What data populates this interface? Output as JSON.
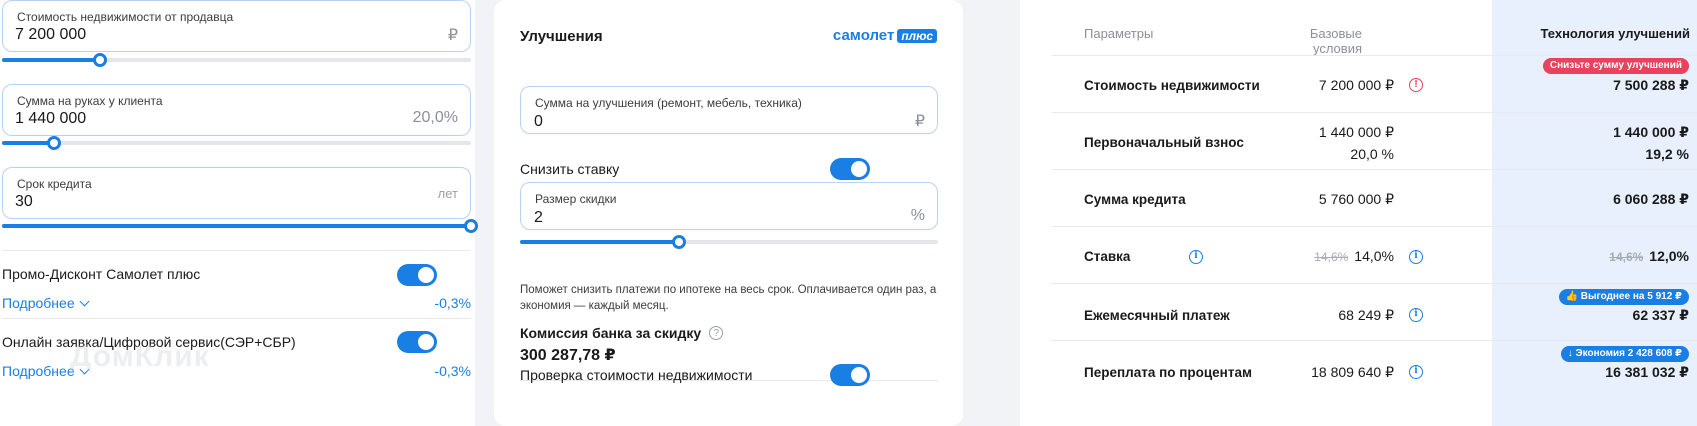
{
  "left": {
    "property_price": {
      "label": "Стоимость недвижимости от продавца",
      "value": "7 200 000",
      "suffix": "₽",
      "slider_fraction": 0.21
    },
    "client_cash": {
      "label": "Сумма на руках у клиента",
      "value": "1 440 000",
      "suffix": "20,0%",
      "slider_fraction": 0.11
    },
    "loan_term": {
      "label": "Срок кредита",
      "value": "30",
      "suffix": "лет",
      "slider_fraction": 1.0
    },
    "promos": [
      {
        "title": "Промо-Дисконт Самолет плюс",
        "more": "Подробнее",
        "pct": "-0,3%",
        "enabled": true
      },
      {
        "title": "Онлайн заявка/Цифровой сервис(СЭР+СБР)",
        "more": "Подробнее",
        "pct": "-0,3%",
        "enabled": true
      }
    ],
    "watermark": "ДомКлик"
  },
  "mid": {
    "title": "Улучшения",
    "brand": {
      "name": "самолет",
      "plus": "плюс"
    },
    "improvements": {
      "label": "Сумма на улучшения (ремонт, мебель, техника)",
      "value": "0",
      "suffix": "₽"
    },
    "lower_rate": {
      "label": "Снизить ставку",
      "enabled": true
    },
    "discount": {
      "label": "Размер скидки",
      "value": "2",
      "suffix": "%",
      "slider_fraction": 0.38
    },
    "hint": "Поможет снизить платежи по ипотеке на весь срок. Оплачивается один раз, а экономия — каждый месяц.",
    "commission": {
      "label": "Комиссия банка за скидку",
      "value": "300 287,78 ₽"
    },
    "check": {
      "label": "Проверка стоимости недвижимости",
      "enabled": true
    }
  },
  "table": {
    "headers": {
      "params": "Параметры",
      "base": "Базовые условия",
      "tech": "Технология улучшений"
    },
    "rows": [
      {
        "name": "Стоимость недвижимости",
        "base": "7 200 000 ₽",
        "tech": "7 500 288 ₽",
        "badge": "Снизьте сумму улучшений"
      },
      {
        "name": "Первоначальный взнос",
        "base": "1 440 000 ₽",
        "base2": "20,0 %",
        "tech": "1 440 000 ₽",
        "tech2": "19,2 %"
      },
      {
        "name": "Сумма кредита",
        "base": "5 760 000 ₽",
        "tech": "6 060 288 ₽"
      },
      {
        "name": "Ставка",
        "base_old": "14,6%",
        "base": "14,0%",
        "tech_old": "14,6%",
        "tech": "12,0%"
      },
      {
        "name": "Ежемесячный платеж",
        "base": "68 249 ₽",
        "tech": "62 337 ₽",
        "badge": "👍 Выгоднее на 5 912 ₽"
      },
      {
        "name": "Переплата по процентам",
        "base": "18 809 640 ₽",
        "tech": "16 381 032 ₽",
        "badge": "↓ Экономия 2 428 608 ₽"
      }
    ]
  },
  "colors": {
    "accent": "#1a7fe4",
    "danger": "#e8425c",
    "tech_bg": "#e8f0fd"
  }
}
